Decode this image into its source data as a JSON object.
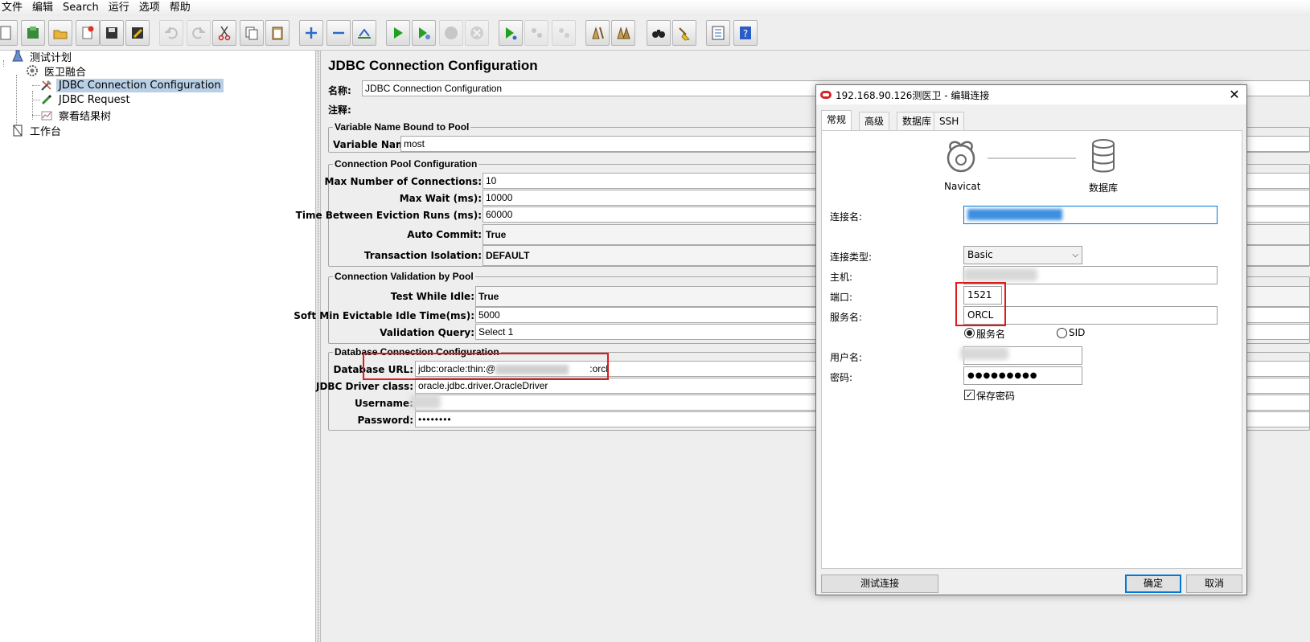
{
  "menubar": {
    "items": [
      "文件",
      "编辑",
      "Search",
      "运行",
      "选项",
      "帮助"
    ]
  },
  "toolbar": {
    "buttons": [
      {
        "icon": "new-file-icon"
      },
      {
        "icon": "templates-icon"
      },
      {
        "icon": "open-icon"
      },
      {
        "icon": "close-file-icon"
      },
      {
        "icon": "save-icon"
      },
      {
        "icon": "save-as-icon"
      },
      {
        "icon": "undo-icon"
      },
      {
        "icon": "redo-icon"
      },
      {
        "icon": "cut-icon"
      },
      {
        "icon": "copy-icon"
      },
      {
        "icon": "paste-icon"
      },
      {
        "icon": "expand-icon"
      },
      {
        "icon": "collapse-icon"
      },
      {
        "icon": "toggle-icon"
      },
      {
        "icon": "start-icon"
      },
      {
        "icon": "start-no-pause-icon"
      },
      {
        "icon": "stop-icon"
      },
      {
        "icon": "shutdown-icon"
      },
      {
        "icon": "remote-start-icon"
      },
      {
        "icon": "remote-stop-icon"
      },
      {
        "icon": "remote-shutdown-icon"
      },
      {
        "icon": "clear-icon"
      },
      {
        "icon": "clear-all-icon"
      },
      {
        "icon": "search-binoculars-icon"
      },
      {
        "icon": "reset-search-icon"
      },
      {
        "icon": "function-helper-icon"
      },
      {
        "icon": "help-icon"
      }
    ]
  },
  "tree": {
    "test_plan": "测试计划",
    "thread_group": "医卫融合",
    "jdbc_config": "JDBC Connection Configuration",
    "jdbc_request": "JDBC Request",
    "results_tree": "察看结果树",
    "workbench": "工作台"
  },
  "main": {
    "title": "JDBC Connection Configuration",
    "name_label": "名称:",
    "name_value": "JDBC Connection Configuration",
    "comment_label": "注释:",
    "var_group": {
      "legend": "Variable Name Bound to Pool",
      "var_label": "Variable Name:",
      "var_value": "most"
    },
    "pool_group": {
      "legend": "Connection Pool Configuration",
      "max_conn_label": "Max Number of Connections:",
      "max_conn_value": "10",
      "max_wait_label": "Max Wait (ms):",
      "max_wait_value": "10000",
      "eviction_label": "Time Between Eviction Runs (ms):",
      "eviction_value": "60000",
      "auto_commit_label": "Auto Commit:",
      "auto_commit_value": "True",
      "isolation_label": "Transaction Isolation:",
      "isolation_value": "DEFAULT"
    },
    "validation_group": {
      "legend": "Connection Validation by Pool",
      "test_idle_label": "Test While Idle:",
      "test_idle_value": "True",
      "soft_min_label": "Soft Min Evictable Idle Time(ms):",
      "soft_min_value": "5000",
      "query_label": "Validation Query:",
      "query_value": "Select 1"
    },
    "db_group": {
      "legend": "Database Connection Configuration",
      "url_label": "Database URL:",
      "url_value_prefix": "jdbc:oracle:thin:@",
      "url_value_suffix": ":orcl",
      "driver_label": "JDBC Driver class:",
      "driver_value": "oracle.jdbc.driver.OracleDriver",
      "username_label": "Username:",
      "password_label": "Password:",
      "password_value": "••••••••"
    }
  },
  "dialog": {
    "title": "192.168.90.126测医卫 - 编辑连接",
    "tabs": [
      "常规",
      "高级",
      "数据库",
      "SSH"
    ],
    "navicat_label": "Navicat",
    "database_label": "数据库",
    "conn_name_label": "连接名:",
    "conn_type_label": "连接类型:",
    "conn_type_value": "Basic",
    "host_label": "主机:",
    "port_label": "端口:",
    "port_value": "1521",
    "service_label": "服务名:",
    "service_value": "ORCL",
    "radio_service": "服务名",
    "radio_sid": "SID",
    "user_label": "用户名:",
    "pwd_label": "密码:",
    "pwd_value": "●●●●●●●●●",
    "save_pwd_label": "保存密码",
    "test_button": "测试连接",
    "ok_button": "确定",
    "cancel_button": "取消",
    "colors": {
      "accent": "#0078d7",
      "highlight_box": "#e01b1b",
      "selection": "#b8cfe5"
    }
  }
}
